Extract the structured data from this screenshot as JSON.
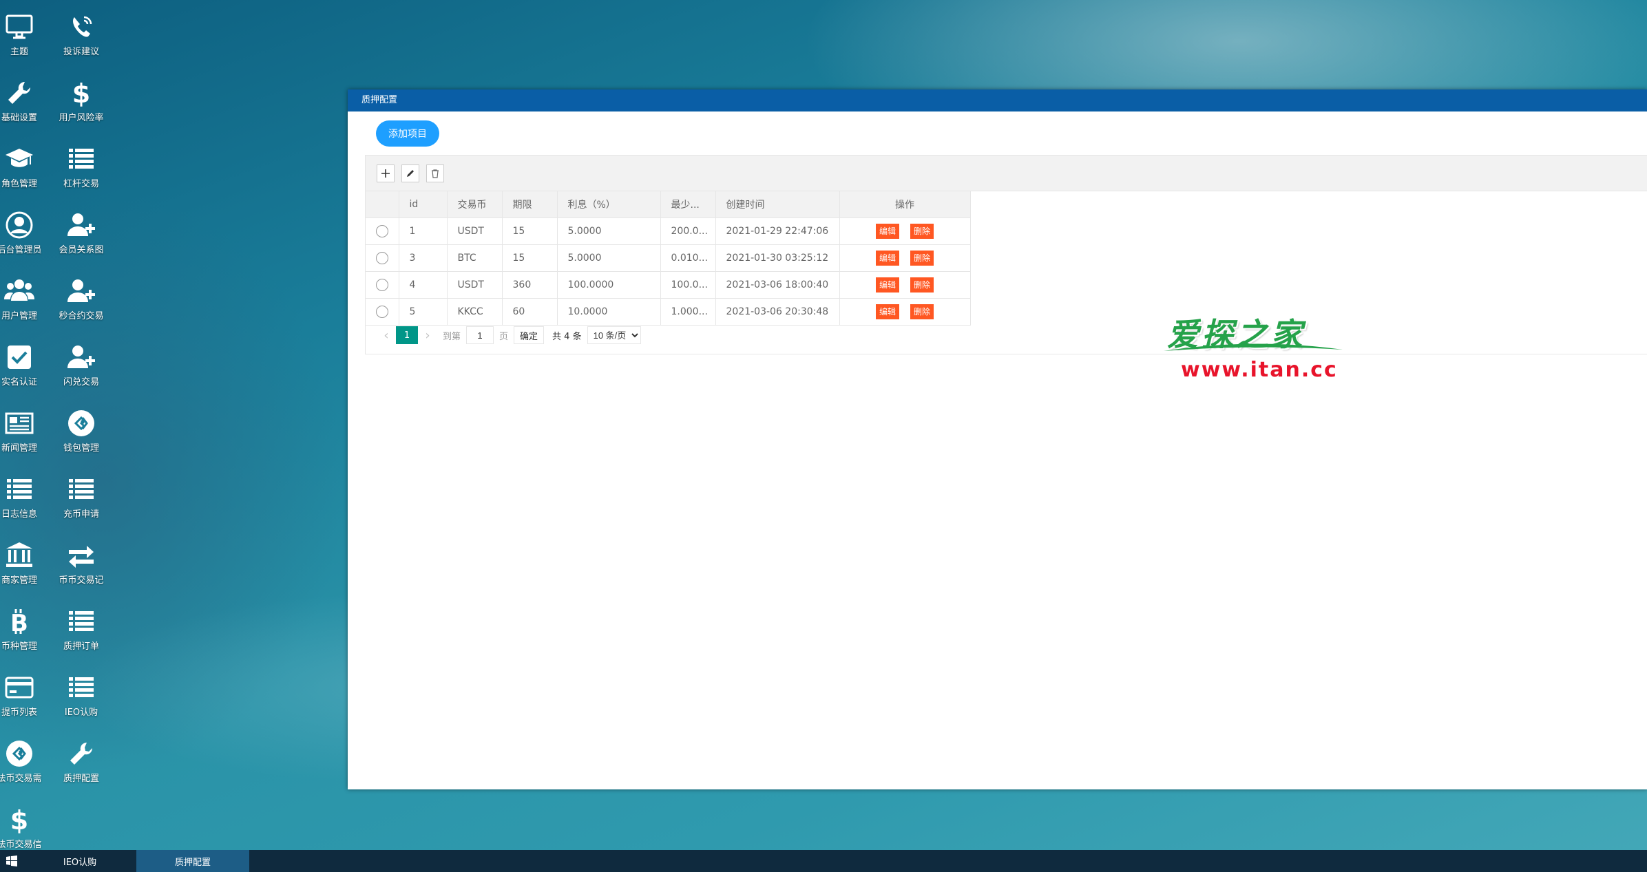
{
  "desktop": {
    "icons": [
      {
        "label": "主题",
        "icon": "monitor-icon"
      },
      {
        "label": "投诉建议",
        "icon": "phone-icon"
      },
      {
        "label": "基础设置",
        "icon": "wrench-icon"
      },
      {
        "label": "用户风险率",
        "icon": "dollar-icon"
      },
      {
        "label": "角色管理",
        "icon": "graduation-cap-icon"
      },
      {
        "label": "杠杆交易",
        "icon": "list-icon"
      },
      {
        "label": "后台管理员",
        "icon": "user-circle-icon"
      },
      {
        "label": "会员关系图",
        "icon": "user-plus-icon"
      },
      {
        "label": "用户管理",
        "icon": "users-icon"
      },
      {
        "label": "秒合约交易",
        "icon": "user-plus-icon"
      },
      {
        "label": "实名认证",
        "icon": "checkbox-icon"
      },
      {
        "label": "闪兑交易",
        "icon": "user-plus-icon"
      },
      {
        "label": "新闻管理",
        "icon": "newspaper-icon"
      },
      {
        "label": "钱包管理",
        "icon": "wallet-circle-icon"
      },
      {
        "label": "日志信息",
        "icon": "list-icon"
      },
      {
        "label": "充币申请",
        "icon": "list-icon"
      },
      {
        "label": "商家管理",
        "icon": "bank-icon"
      },
      {
        "label": "币币交易记",
        "icon": "exchange-icon"
      },
      {
        "label": "币种管理",
        "icon": "bitcoin-icon"
      },
      {
        "label": "质押订单",
        "icon": "list-icon"
      },
      {
        "label": "提币列表",
        "icon": "credit-card-icon"
      },
      {
        "label": "IEO认购",
        "icon": "list-icon"
      },
      {
        "label": "法币交易需",
        "icon": "wallet-circle-icon"
      },
      {
        "label": "质押配置",
        "icon": "wrench-icon"
      },
      {
        "label": "法币交易信",
        "icon": "dollar-icon"
      }
    ]
  },
  "window": {
    "title": "质押配置",
    "add_button": "添加项目",
    "table": {
      "headers": [
        "id",
        "交易币",
        "期限",
        "利息（%）",
        "最少...",
        "创建时间",
        "操作"
      ],
      "rows": [
        {
          "id": "1",
          "coin": "USDT",
          "term": "15",
          "interest": "5.0000",
          "min": "200.0...",
          "created": "2021-01-29 22:47:06"
        },
        {
          "id": "3",
          "coin": "BTC",
          "term": "15",
          "interest": "5.0000",
          "min": "0.010...",
          "created": "2021-01-30 03:25:12"
        },
        {
          "id": "4",
          "coin": "USDT",
          "term": "360",
          "interest": "100.0000",
          "min": "100.0...",
          "created": "2021-03-06 18:00:40"
        },
        {
          "id": "5",
          "coin": "KKCC",
          "term": "60",
          "interest": "10.0000",
          "min": "1.000...",
          "created": "2021-03-06 20:30:48"
        }
      ],
      "edit_label": "编辑",
      "delete_label": "删除"
    },
    "pager": {
      "current_page": "1",
      "goto_label": "到第",
      "page_input": "1",
      "page_unit": "页",
      "confirm": "确定",
      "total": "共 4 条",
      "page_size": "10 条/页"
    }
  },
  "watermark": {
    "title": "爱探之家",
    "url": "www.itan.cc"
  },
  "taskbar": {
    "items": [
      {
        "label": "IEO认购",
        "active": false
      },
      {
        "label": "质押配置",
        "active": true
      }
    ]
  },
  "colors": {
    "window_title_bg": "#0a5ea6",
    "add_button": "#1e9fff",
    "action_button": "#ff5722",
    "pager_current": "#009688",
    "taskbar": "#0f2a3e"
  }
}
